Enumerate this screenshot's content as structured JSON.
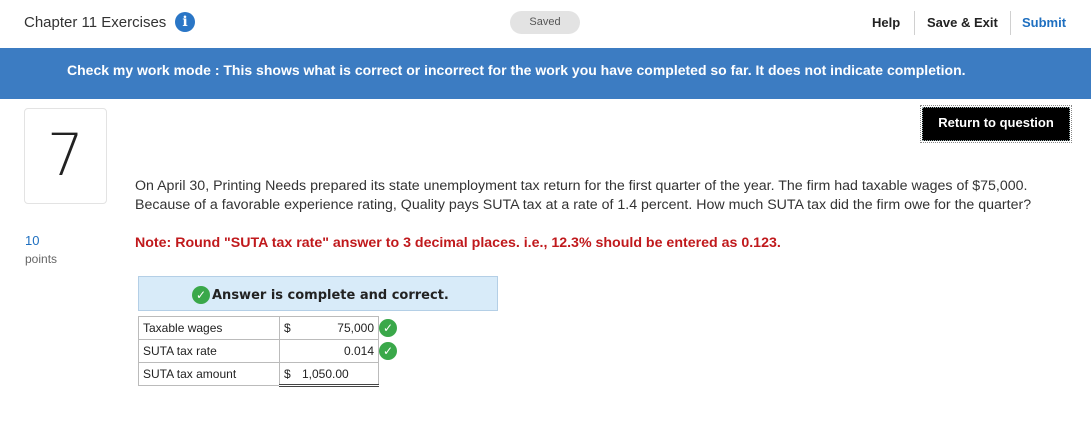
{
  "header": {
    "title": "Chapter 11 Exercises",
    "info_icon": "i",
    "saved_label": "Saved",
    "help_label": "Help",
    "save_exit_label": "Save & Exit",
    "submit_label": "Submit"
  },
  "banner": {
    "text": "Check my work mode : This shows what is correct or incorrect for the work you have completed so far. It does not indicate completion."
  },
  "question": {
    "number": "7",
    "points_value": "10",
    "points_label": "points",
    "return_label": "Return to question",
    "text": "On April 30, Printing Needs prepared its state unemployment tax return for the first quarter of the year. The firm had taxable wages of $75,000. Because of a favorable experience rating, Quality pays SUTA tax at a rate of 1.4 percent. How much SUTA tax did the firm owe for the quarter?",
    "note": "Note: Round \"SUTA tax rate\" answer to 3 decimal places. i.e., 12.3% should be entered as 0.123."
  },
  "answer": {
    "status": "Answer is complete and correct.",
    "check_icon": "✓",
    "rows": [
      {
        "label": "Taxable wages",
        "currency": "$",
        "value": "75,000",
        "correct": true
      },
      {
        "label": "SUTA tax rate",
        "currency": "",
        "value": "0.014",
        "correct": true
      },
      {
        "label": "SUTA tax amount",
        "currency": "$",
        "value": "1,050.00",
        "correct": false
      }
    ]
  },
  "colors": {
    "banner": "#3c7cc2",
    "accent_blue": "#1e6fc0",
    "note_red": "#c0191c",
    "check_green": "#3aa84a",
    "answer_header_bg": "#d8ebf9"
  }
}
